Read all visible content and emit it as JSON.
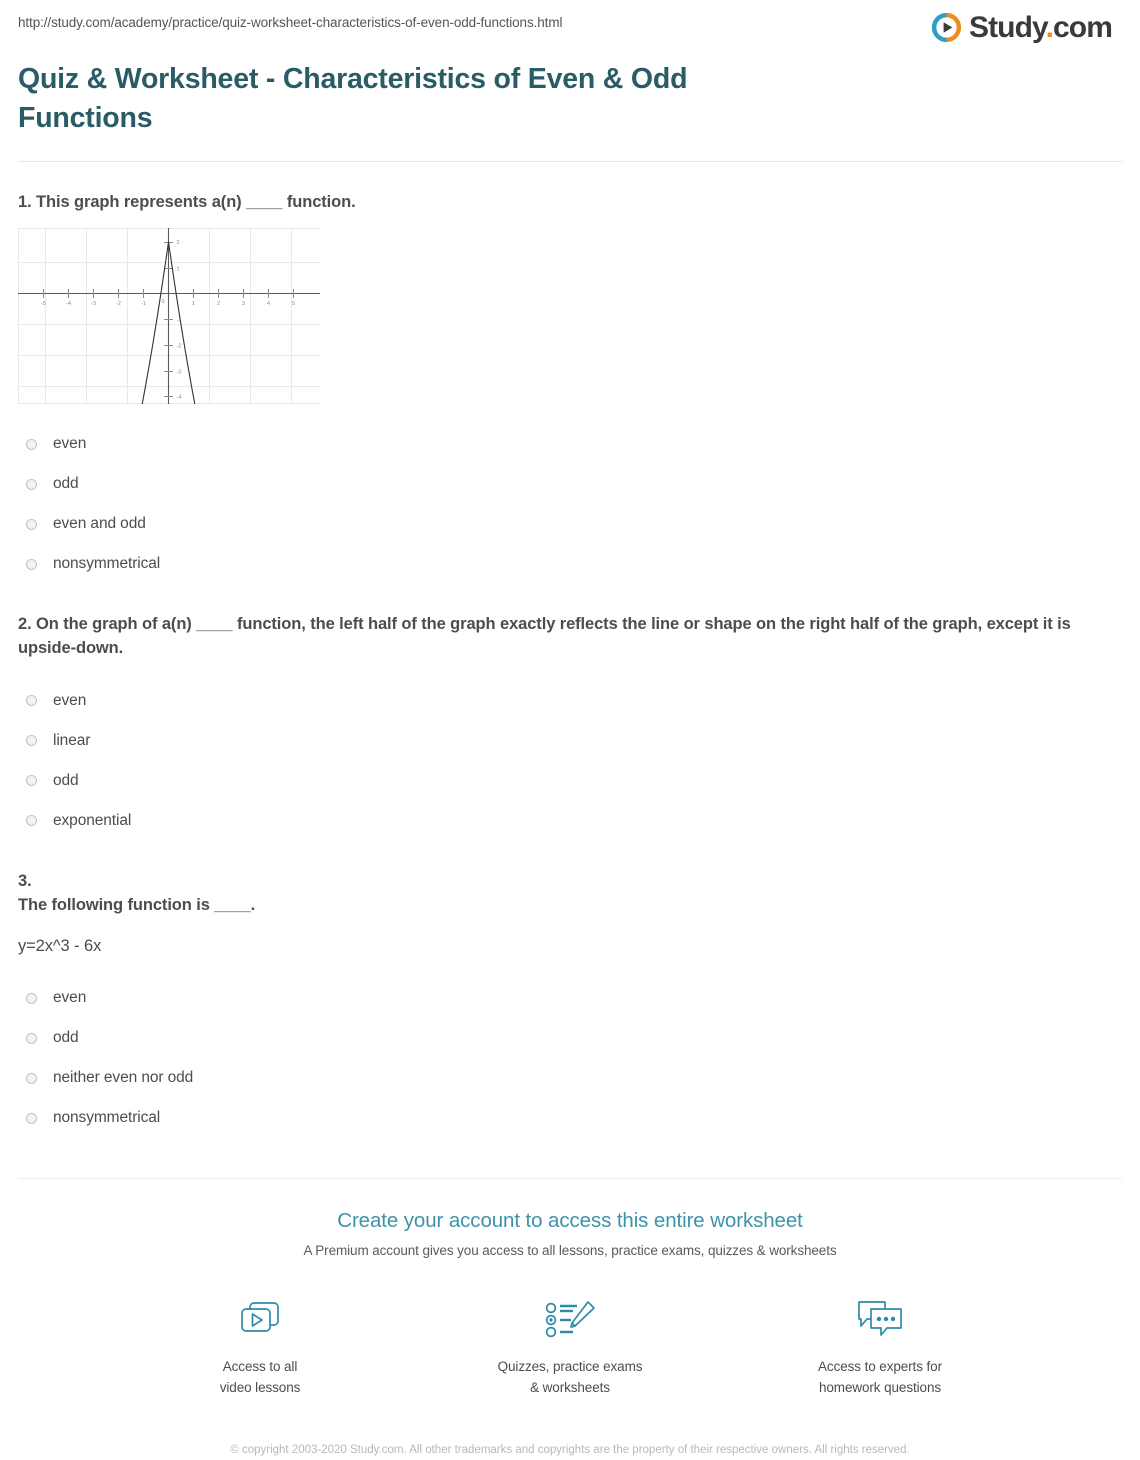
{
  "browser": {
    "url": "http://study.com/academy/practice/quiz-worksheet-characteristics-of-even-odd-functions.html"
  },
  "brand": {
    "name_main": "Study",
    "name_dot": ".",
    "name_tld": "com",
    "icon": "play-circle-icon",
    "color_blue": "#2e9fc4",
    "color_orange": "#f08b1d",
    "color_text": "#3a3a3a"
  },
  "header": {
    "title": "Quiz & Worksheet - Characteristics of Even & Odd Functions",
    "title_color": "#2a5c67"
  },
  "questions": [
    {
      "text": "1. This graph represents a(n) ____ function.",
      "has_graph": true,
      "options": [
        "even",
        "odd",
        "even and odd",
        "nonsymmetrical"
      ]
    },
    {
      "text": "2. On the graph of a(n) ____ function, the left half of the graph exactly reflects the line or shape on the right half of the graph, except it is upside-down.",
      "has_graph": false,
      "options": [
        "even",
        "linear",
        "odd",
        "exponential"
      ]
    },
    {
      "number_text": "3.",
      "text": "The following function is ____.",
      "subtext": "y=2x^3 - 6x",
      "has_graph": false,
      "options": [
        "even",
        "odd",
        "neither even nor odd",
        "nonsymmetrical"
      ]
    }
  ],
  "chart_data": {
    "type": "line",
    "title": "",
    "xlabel": "",
    "ylabel": "",
    "xlim": [
      -5.5,
      5.5
    ],
    "ylim": [
      -4.6,
      2.4
    ],
    "xticks": [
      -5,
      -4,
      -3,
      -2,
      -1,
      0,
      1,
      2,
      3,
      4,
      5
    ],
    "yticks": [
      2,
      1,
      0,
      -1,
      -2,
      -3,
      -4
    ],
    "grid": true,
    "equation": "y = -6x^2 + 2",
    "vertex": [
      0,
      2
    ],
    "x_intercepts": [
      -0.577,
      0.577
    ],
    "series": [
      {
        "name": "parabola",
        "x": [
          -1.05,
          -0.9,
          -0.75,
          -0.6,
          -0.45,
          -0.3,
          -0.15,
          0,
          0.15,
          0.3,
          0.45,
          0.6,
          0.75,
          0.9,
          1.05
        ],
        "y": [
          -4.6,
          -2.86,
          -1.375,
          -0.16,
          0.785,
          1.46,
          1.865,
          2,
          1.865,
          1.46,
          0.785,
          -0.16,
          -1.375,
          -2.86,
          -4.6
        ]
      }
    ]
  },
  "footer": {
    "cta_title": "Create your account to access this entire worksheet",
    "cta_title_color": "#3e93ab",
    "cta_subtitle": "A Premium account gives you access to all lessons, practice exams, quizzes & worksheets",
    "features": [
      {
        "icon": "video-lessons-icon",
        "label_line1": "Access to all",
        "label_line2": "video lessons"
      },
      {
        "icon": "quiz-pencil-icon",
        "label_line1": "Quizzes, practice exams",
        "label_line2": "& worksheets"
      },
      {
        "icon": "chat-bubbles-icon",
        "label_line1": "Access to experts for",
        "label_line2": "homework questions"
      }
    ],
    "copyright": "© copyright 2003-2020 Study.com. All other trademarks and copyrights are the property of their respective owners. All rights reserved."
  }
}
